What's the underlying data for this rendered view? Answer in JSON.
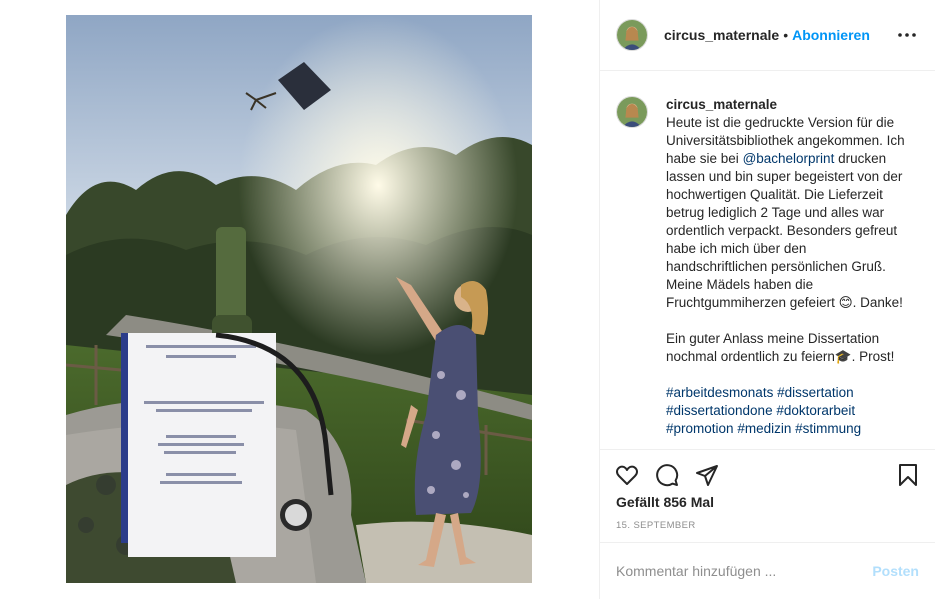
{
  "post": {
    "username": "circus_maternale",
    "follow_separator": "•",
    "follow_label": "Abonnieren"
  },
  "caption": {
    "username": "circus_maternale",
    "text_1": "Heute ist die gedruckte Version für die Universitätsbibliothek angekommen. Ich habe sie bei ",
    "mention": "@bachelorprint",
    "text_2": " drucken lassen und bin super begeistert von der hochwertigen Qualität. Die Lieferzeit betrug lediglich 2 Tage und alles war ordentlich verpackt. Besonders gefreut habe ich mich über den handschriftlichen persönlichen Gruß. Meine Mädels haben die Fruchtgummiherzen gefeiert 😊. Danke!",
    "text_3": "Ein guter Anlass meine Dissertation nochmal ordentlich zu feiern🎓. Prost!",
    "hashtags": [
      "#arbeitdesmonats",
      "#dissertation",
      "#dissertationdone",
      "#doktorarbeit",
      "#promotion",
      "#medizin",
      "#stimmung"
    ]
  },
  "likes_text": "Gefällt 856 Mal",
  "date_text": "15. SEPTEMBER",
  "comment_box": {
    "placeholder": "Kommentar hinzufügen ...",
    "post_label": "Posten"
  },
  "icons": {
    "more": "more-horizontal-icon",
    "like": "heart-icon",
    "comment": "comment-bubble-icon",
    "share": "paper-plane-icon",
    "save": "bookmark-icon"
  },
  "colors": {
    "link": "#0095f6",
    "mention": "#00376b",
    "muted": "#8e8e8e",
    "post_disabled": "#b2dffc"
  }
}
